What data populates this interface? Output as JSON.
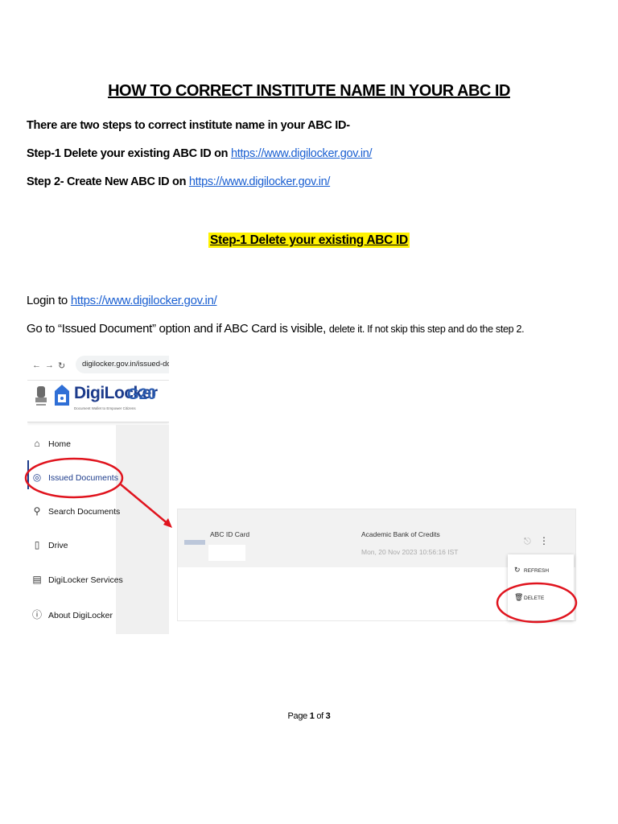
{
  "title": "HOW TO CORRECT INSTITUTE NAME IN YOUR ABC ID",
  "intro": "There are two steps to correct institute name in your ABC ID-",
  "steps": [
    {
      "text": "Step-1 Delete your existing ABC ID on ",
      "link": "https://www.digilocker.gov.in/"
    },
    {
      "text": "Step 2- Create New ABC ID on ",
      "link": "https://www.digilocker.gov.in/"
    }
  ],
  "section_heading": "Step-1 Delete your existing ABC ID",
  "login": {
    "text": "Login to ",
    "link": "https://www.digilocker.gov.in/"
  },
  "instruction": {
    "part1": "Go to “Issued Document” option and if ABC Card is visible, ",
    "part2": "delete it. If not skip this step and do the step 2."
  },
  "screenshot1": {
    "address": "digilocker.gov.in/issued-documents",
    "brand": "DigiLocker",
    "tagline": "Document Wallet to Empower Citizens",
    "g20": "G20",
    "menu": [
      {
        "label": "Home",
        "icon": "home-icon"
      },
      {
        "label": "Issued Documents",
        "icon": "badge-icon"
      },
      {
        "label": "Search Documents",
        "icon": "search-icon"
      },
      {
        "label": "Drive",
        "icon": "drive-icon"
      },
      {
        "label": "DigiLocker Services",
        "icon": "services-icon"
      },
      {
        "label": "About DigiLocker",
        "icon": "info-icon"
      }
    ]
  },
  "screenshot2": {
    "doc_name": "ABC ID Card",
    "issuer": "Academic Bank of Credits",
    "date": "Mon, 20 Nov 2023 10:56:16 IST",
    "menu": [
      "REFRESH",
      "DELETE"
    ]
  },
  "colors": {
    "highlight": "#fff200",
    "link": "#1a5fd1",
    "annotation": "#e0141e",
    "brand": "#1c3b8b"
  },
  "footer": {
    "prefix": "Page ",
    "current": "1",
    "middle": " of ",
    "total": "3"
  }
}
